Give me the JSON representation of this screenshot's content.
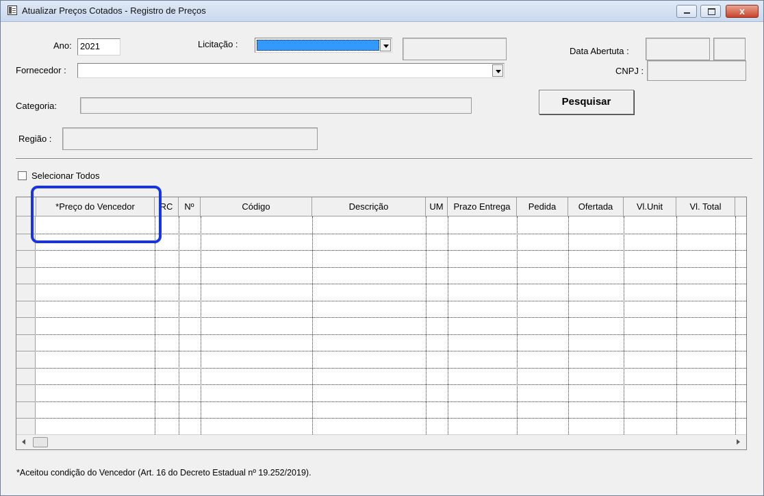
{
  "window": {
    "title": "Atualizar Preços Cotados - Registro de Preços",
    "controls": {
      "close": "x"
    }
  },
  "form": {
    "ano_label": "Ano:",
    "ano_value": "2021",
    "licitacao_label": "Licitação :",
    "licitacao_value": "",
    "data_abertura_label": "Data Abertuta :",
    "fornecedor_label": "Fornecedor :",
    "fornecedor_value": "",
    "cnpj_label": "CNPJ :",
    "categoria_label": "Categoria:",
    "regiao_label": "Região :",
    "pesquisar_label": "Pesquisar",
    "selecionar_todos_label": "Selecionar Todos"
  },
  "grid": {
    "columns": [
      "*Preço do Vencedor",
      "RC",
      "Nº",
      "Código",
      "Descrição",
      "UM",
      "Prazo Entrega",
      "Pedida",
      "Ofertada",
      "Vl.Unit",
      "Vl. Total"
    ],
    "rows": []
  },
  "footnote": "*Aceitou condição do Vencedor (Art. 16 do Decreto Estadual nº 19.252/2019).",
  "colors": {
    "highlight": "#1533e8",
    "licitacao_selection": "#3399ff"
  }
}
